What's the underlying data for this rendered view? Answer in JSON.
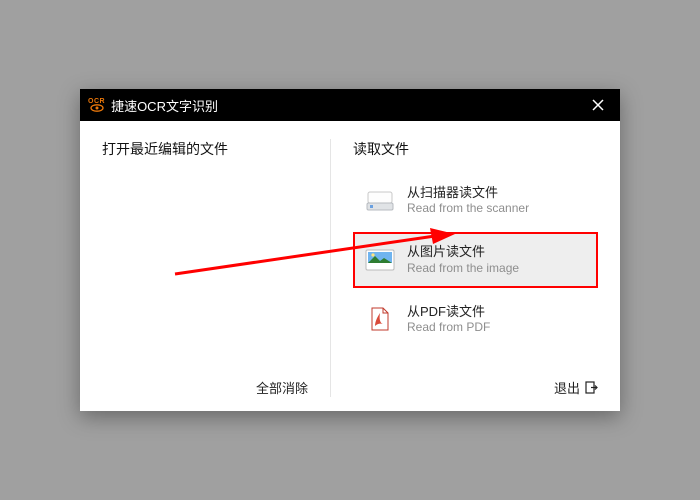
{
  "titlebar": {
    "logo_text": "OCR",
    "title": "捷速OCR文字识别"
  },
  "left": {
    "heading": "打开最近编辑的文件",
    "clear": "全部消除"
  },
  "right": {
    "heading": "读取文件",
    "options": [
      {
        "title": "从扫描器读文件",
        "sub": "Read from the scanner"
      },
      {
        "title": "从图片读文件",
        "sub": "Read from the image"
      },
      {
        "title": "从PDF读文件",
        "sub": "Read from PDF"
      }
    ],
    "exit": "退出"
  }
}
